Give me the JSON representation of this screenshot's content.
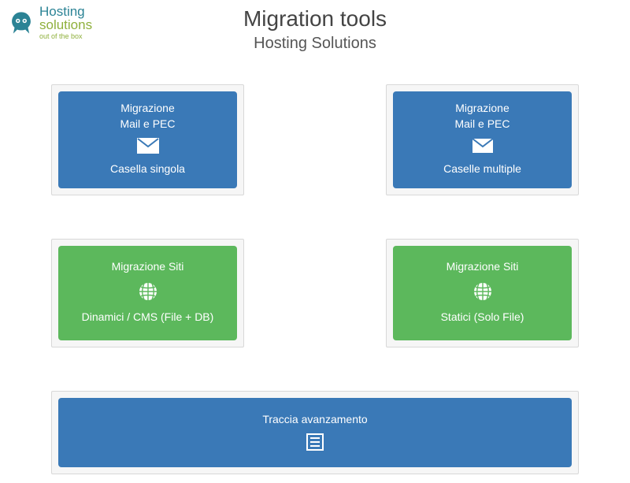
{
  "logo": {
    "line1": "Hosting",
    "line2": "solutions",
    "tagline": "out of the box"
  },
  "header": {
    "title": "Migration tools",
    "subtitle": "Hosting Solutions"
  },
  "cards": {
    "mail_single": {
      "top1": "Migrazione",
      "top2": "Mail e PEC",
      "bottom": "Casella singola"
    },
    "mail_multiple": {
      "top1": "Migrazione",
      "top2": "Mail e PEC",
      "bottom": "Caselle multiple"
    },
    "site_dynamic": {
      "top": "Migrazione Siti",
      "bottom": "Dinamici / CMS (File + DB)"
    },
    "site_static": {
      "top": "Migrazione Siti",
      "bottom": "Statici (Solo File)"
    },
    "track": {
      "label": "Traccia avanzamento"
    }
  }
}
